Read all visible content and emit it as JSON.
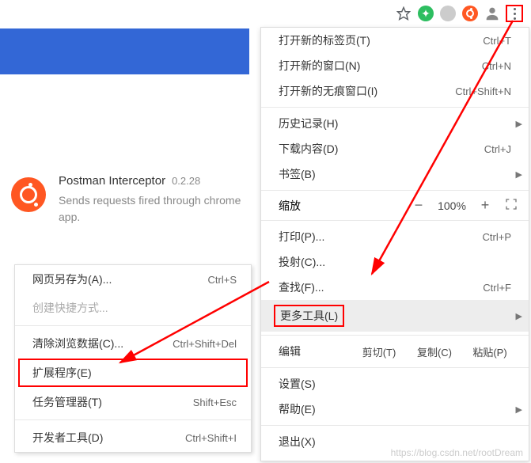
{
  "extension": {
    "name": "Postman Interceptor",
    "version": "0.2.28",
    "description": "Sends requests fired through chrome app."
  },
  "submenu": {
    "save_as": "网页另存为(A)...",
    "save_as_key": "Ctrl+S",
    "create_shortcut": "创建快捷方式...",
    "clear_data": "清除浏览数据(C)...",
    "clear_data_key": "Ctrl+Shift+Del",
    "extensions": "扩展程序(E)",
    "task_manager": "任务管理器(T)",
    "task_manager_key": "Shift+Esc",
    "dev_tools": "开发者工具(D)",
    "dev_tools_key": "Ctrl+Shift+I"
  },
  "mainmenu": {
    "new_tab": "打开新的标签页(T)",
    "new_tab_key": "Ctrl+T",
    "new_window": "打开新的窗口(N)",
    "new_window_key": "Ctrl+N",
    "new_incognito": "打开新的无痕窗口(I)",
    "new_incognito_key": "Ctrl+Shift+N",
    "history": "历史记录(H)",
    "downloads": "下载内容(D)",
    "downloads_key": "Ctrl+J",
    "bookmarks": "书签(B)",
    "zoom_label": "缩放",
    "zoom_value": "100%",
    "print": "打印(P)...",
    "print_key": "Ctrl+P",
    "cast": "投射(C)...",
    "find": "查找(F)...",
    "find_key": "Ctrl+F",
    "more_tools": "更多工具(L)",
    "edit_label": "编辑",
    "cut": "剪切(T)",
    "copy": "复制(C)",
    "paste": "粘贴(P)",
    "settings": "设置(S)",
    "help": "帮助(E)",
    "exit": "退出(X)"
  },
  "watermark": "https://blog.csdn.net/rootDream"
}
